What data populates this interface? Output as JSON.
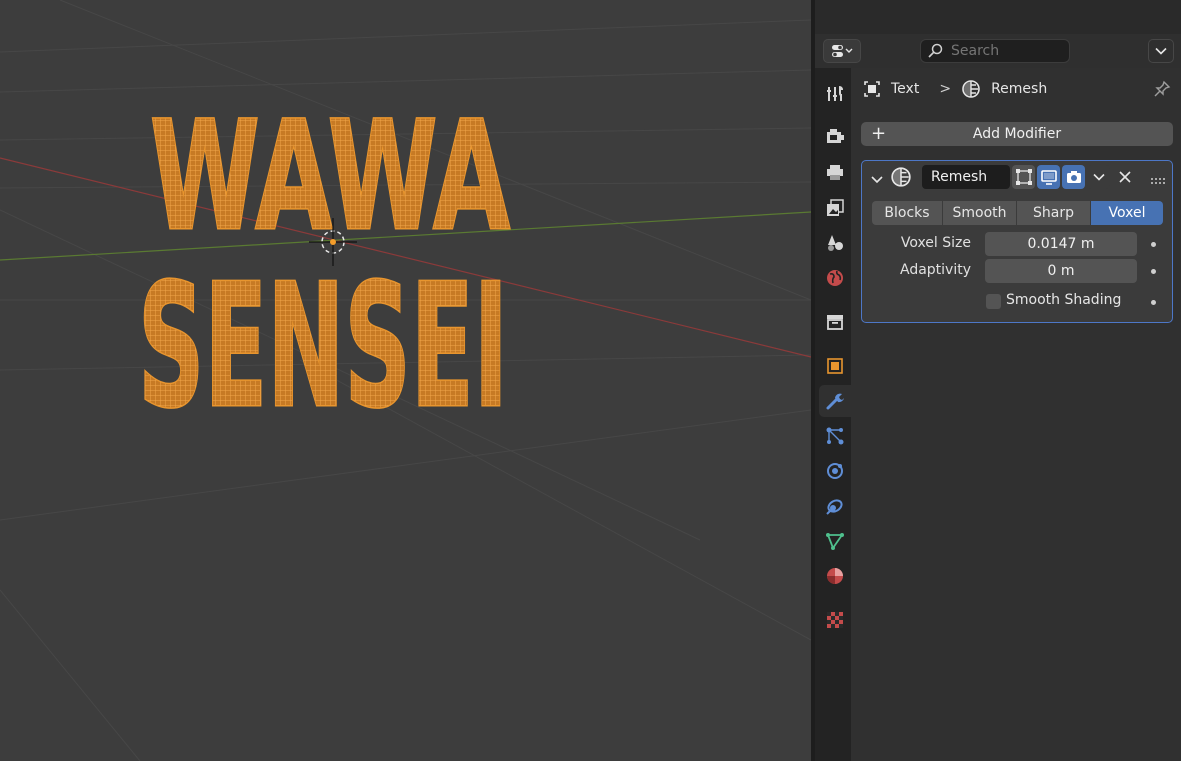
{
  "viewport": {
    "text_line_1": "WAWA",
    "text_line_2": "SENSEI",
    "colors": {
      "background": "#3d3d3d",
      "mesh_orange": "#e8952e",
      "x_axis": "#8b3a3a",
      "y_axis": "#5a7a32"
    }
  },
  "header": {
    "editor_type_icon": "properties-editor-icon",
    "search": {
      "placeholder": "Search",
      "value": ""
    }
  },
  "tabs": [
    {
      "name": "tool-tab",
      "icon": "tool-icon",
      "active": false
    },
    {
      "name": "render-tab",
      "icon": "render-icon",
      "active": false
    },
    {
      "name": "output-tab",
      "icon": "output-icon",
      "active": false
    },
    {
      "name": "view-layer-tab",
      "icon": "view-layer-icon",
      "active": false
    },
    {
      "name": "scene-tab",
      "icon": "scene-icon",
      "active": false
    },
    {
      "name": "world-tab",
      "icon": "world-icon",
      "active": false
    },
    {
      "name": "collection-tab",
      "icon": "collection-icon",
      "active": false
    },
    {
      "name": "object-tab",
      "icon": "object-icon",
      "active": false
    },
    {
      "name": "modifier-tab",
      "icon": "wrench-icon",
      "active": true
    },
    {
      "name": "particles-tab",
      "icon": "particles-icon",
      "active": false
    },
    {
      "name": "physics-tab",
      "icon": "physics-icon",
      "active": false
    },
    {
      "name": "constraints-tab",
      "icon": "constraints-icon",
      "active": false
    },
    {
      "name": "data-tab",
      "icon": "data-icon",
      "active": false
    },
    {
      "name": "material-tab",
      "icon": "material-icon",
      "active": false
    },
    {
      "name": "texture-tab",
      "icon": "texture-icon",
      "active": false
    }
  ],
  "breadcrumb": {
    "object": "Text",
    "separator": ">",
    "modifier": "Remesh"
  },
  "add_modifier": {
    "label": "Add Modifier",
    "plus": "+"
  },
  "modifier": {
    "name": "Remesh",
    "modes": [
      "Blocks",
      "Smooth",
      "Sharp",
      "Voxel"
    ],
    "active_mode": "Voxel",
    "voxel_size": {
      "label": "Voxel Size",
      "value": "0.0147 m"
    },
    "adaptivity": {
      "label": "Adaptivity",
      "value": "0 m"
    },
    "smooth_shading": {
      "label": "Smooth Shading",
      "checked": false
    },
    "accent": "#4772b3"
  }
}
